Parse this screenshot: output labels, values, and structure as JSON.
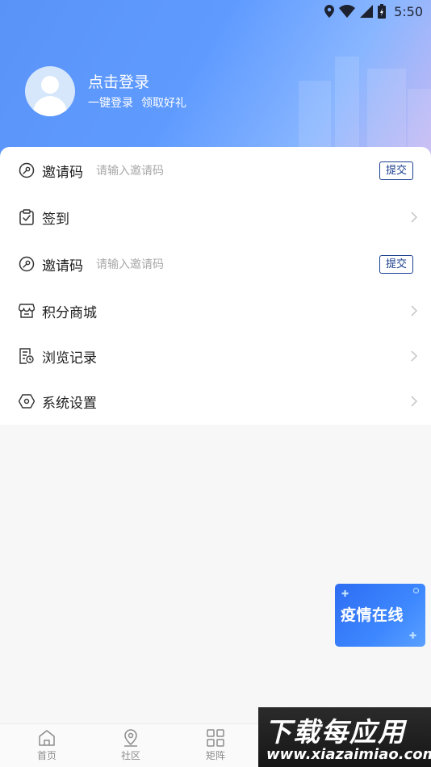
{
  "status_bar": {
    "time": "5:50",
    "icons": [
      "location-icon",
      "wifi-icon",
      "signal-icon",
      "battery-icon"
    ]
  },
  "profile": {
    "title": "点击登录",
    "sub_1": "一键登录",
    "sub_2": "领取好礼"
  },
  "menu": {
    "invite_1": {
      "label": "邀请码",
      "placeholder": "请输入邀请码",
      "button": "提交",
      "icon": "key-icon"
    },
    "checkin": {
      "label": "签到",
      "icon": "clipboard-check-icon"
    },
    "invite_2": {
      "label": "邀请码",
      "placeholder": "请输入邀请码",
      "button": "提交",
      "icon": "key-icon"
    },
    "mall": {
      "label": "积分商城",
      "icon": "store-icon"
    },
    "history": {
      "label": "浏览记录",
      "icon": "history-doc-icon"
    },
    "settings": {
      "label": "系统设置",
      "icon": "hexagon-settings-icon"
    }
  },
  "float_banner": {
    "text": "疫情在线"
  },
  "tabbar": {
    "tabs": [
      {
        "label": "首页",
        "icon": "home-icon"
      },
      {
        "label": "社区",
        "icon": "location-pin-icon"
      },
      {
        "label": "矩阵",
        "icon": "grid-icon"
      }
    ]
  },
  "watermark": {
    "line1": "下载每应用",
    "line2": "www.xiazaimiao.com"
  },
  "colors": {
    "header_gradient_start": "#5a93f7",
    "header_gradient_end": "#c7b8f2",
    "submit_border": "#1a3f8f",
    "banner_blue": "#2e6df2"
  }
}
